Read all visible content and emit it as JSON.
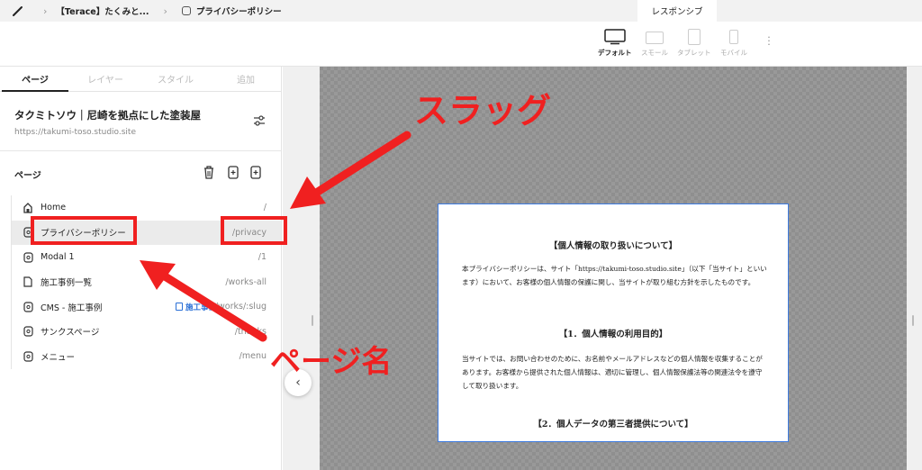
{
  "topbar": {
    "breadcrumb_project": "【Terace】たくみと...",
    "breadcrumb_page": "プライバシーポリシー",
    "tab_responsive": "レスポンシブ"
  },
  "devices": [
    {
      "label": "デフォルト",
      "active": true
    },
    {
      "label": "スモール",
      "active": false
    },
    {
      "label": "タブレット",
      "active": false
    },
    {
      "label": "モバイル",
      "active": false
    }
  ],
  "sidebar": {
    "tabs": [
      "ページ",
      "レイヤー",
      "スタイル",
      "追加"
    ],
    "site_name": "タクミトソウ｜尼崎を拠点にした塗装屋",
    "site_url": "https://takumi-toso.studio.site",
    "pages_heading": "ページ",
    "pages": [
      {
        "name": "Home",
        "slug": "/",
        "icon": "home-icon"
      },
      {
        "name": "プライバシーポリシー",
        "slug": "/privacy",
        "icon": "page-settings-icon",
        "selected": true
      },
      {
        "name": "Modal 1",
        "slug": "/1",
        "icon": "page-settings-icon"
      },
      {
        "name": "施工事例一覧",
        "slug": "/works-all",
        "icon": "document-icon"
      },
      {
        "name": "CMS - 施工事例",
        "slug": "/works/:slug",
        "icon": "page-settings-icon",
        "badge": "施工事例"
      },
      {
        "name": "サンクスページ",
        "slug": "/thanks",
        "icon": "page-settings-icon"
      },
      {
        "name": "メニュー",
        "slug": "/menu",
        "icon": "page-settings-icon"
      }
    ]
  },
  "preview": {
    "heading1": "【個人情報の取り扱いについて】",
    "para1": "本プライバシーポリシーは、サイト「https://takumi-toso.studio.site」（以下「当サイト」といいます）において、お客様の個人情報の保護に関し、当サイトが取り組む方針を示したものです。",
    "heading2": "【1．個人情報の利用目的】",
    "para2": "当サイトでは、お問い合わせのために、お名前やメールアドレスなどの個人情報を収集することがあります。お客様から提供された個人情報は、適切に管理し、個人情報保護法等の関連法令を遵守して取り扱います。",
    "heading3": "【2．個人データの第三者提供について】"
  },
  "annotations": {
    "slug_label": "スラッグ",
    "page_name_label": "ページ名",
    "color": "#f02020"
  }
}
